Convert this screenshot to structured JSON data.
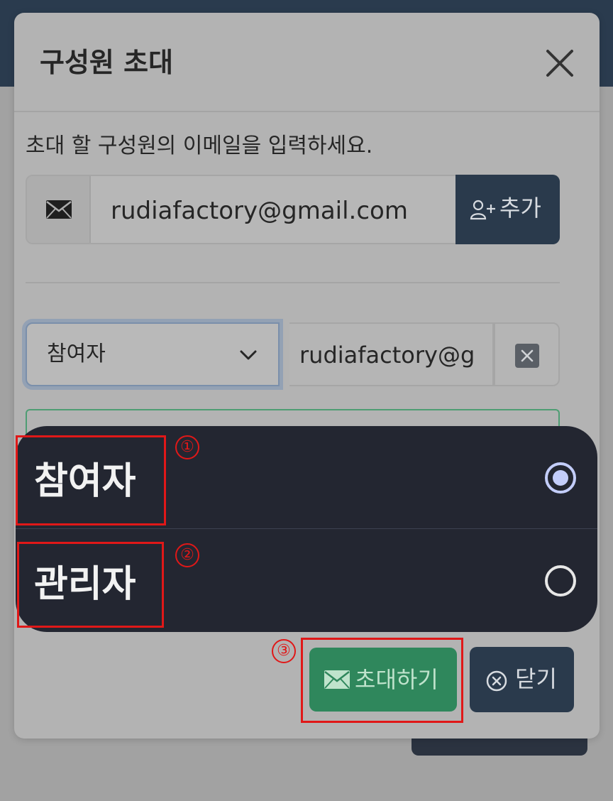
{
  "modal": {
    "title": "구성원 초대",
    "instruction": "초대 할 구성원의 이메일을 입력하세요.",
    "email_value": "rudiafactory@gmail.com",
    "add_label": "추가"
  },
  "member": {
    "role": "참여자",
    "email": "rudiafactory@g"
  },
  "role_options": [
    {
      "label": "참여자",
      "selected": true
    },
    {
      "label": "관리자",
      "selected": false
    }
  ],
  "footer": {
    "invite_label": "초대하기",
    "close_label": "닫기"
  },
  "annotations": [
    "①",
    "②",
    "③"
  ],
  "colors": {
    "header_bg": "#2a3b4e",
    "primary_dark": "#2a3a4c",
    "success": "#2f875c",
    "sheet_bg": "#232631",
    "annotation": "#e01818",
    "radio_selected": "#c3cdfa"
  },
  "icons": {
    "close": "close-icon",
    "email": "envelope-icon",
    "add_user": "person-plus-icon",
    "dropdown": "chevron-down-icon",
    "remove": "x-square-icon",
    "invite": "envelope-icon",
    "close_footer": "x-circle-icon"
  }
}
